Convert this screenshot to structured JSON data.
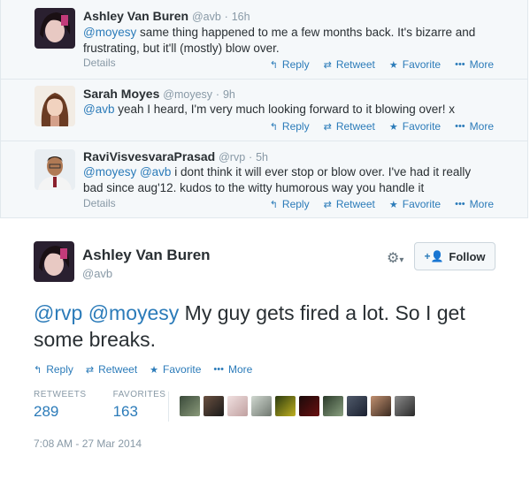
{
  "replies": [
    {
      "name": "Ashley Van Buren",
      "handle": "@avb",
      "time": "16h",
      "mention": "@moyesy",
      "text": " same thing happened to me a few months back. It's bizarre and frustrating, but it'll (mostly) blow over.",
      "details": "Details"
    },
    {
      "name": "Sarah Moyes",
      "handle": "@moyesy",
      "time": "9h",
      "mention": "@avb",
      "text": " yeah I heard, I'm very much looking forward to it blowing over! x",
      "details": "Details"
    },
    {
      "name": "RaviVisvesvaraPrasad",
      "handle": "@rvp",
      "time": "5h",
      "mention": "@moyesy @avb",
      "text": " i dont think it will ever stop or blow over. I've had it really bad since aug'12. kudos to the witty humorous way you handle it",
      "details": "Details"
    }
  ],
  "actions": {
    "reply": "Reply",
    "retweet": "Retweet",
    "favorite": "Favorite",
    "more": "More"
  },
  "main": {
    "name": "Ashley Van Buren",
    "handle": "@avb",
    "mention": "@rvp @moyesy",
    "text": " My guy gets fired a lot. So I get some breaks.",
    "follow_label": "Follow",
    "retweets_label": "RETWEETS",
    "retweets_value": "289",
    "favorites_label": "FAVORITES",
    "favorites_value": "163",
    "timestamp": "7:08 AM - 27 Mar 2014"
  },
  "colors": {
    "link": "#2b7bb9",
    "muted": "#8899a6",
    "reply_bg": "#f5f8fa"
  }
}
